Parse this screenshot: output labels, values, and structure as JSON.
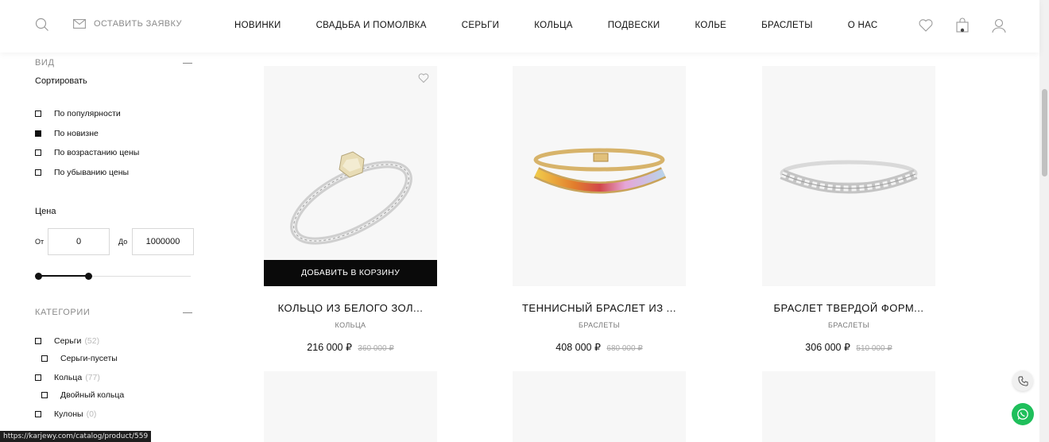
{
  "header": {
    "request_label": "ОСТАВИТЬ ЗАЯВКУ",
    "icons": [
      "search-icon",
      "mail-icon",
      "heart-icon",
      "bag-icon",
      "user-icon"
    ],
    "nav": [
      "НОВИНКИ",
      "СВАДЬБА И ПОМОЛВКА",
      "СЕРЬГИ",
      "КОЛЬЦА",
      "ПОДВЕСКИ",
      "КОЛЬЕ",
      "БРАСЛЕТЫ",
      "О НАС"
    ]
  },
  "sidebar": {
    "view_title": "ВИД",
    "sort_label": "Сортировать",
    "sort_options": [
      {
        "label": "По популярности",
        "checked": false
      },
      {
        "label": "По новизне",
        "checked": true
      },
      {
        "label": "По возрастанию цены",
        "checked": false
      },
      {
        "label": "По убыванию цены",
        "checked": false
      }
    ],
    "price_label": "Цена",
    "from_label": "От",
    "to_label": "До",
    "price_from": "0",
    "price_to": "1000000",
    "categories_title": "КАТЕГОРИИ",
    "categories": [
      {
        "label": "Серьги",
        "count": "(52)"
      },
      {
        "label": "Серьги-пусеты",
        "count": ""
      },
      {
        "label": "Кольца",
        "count": "(77)"
      },
      {
        "label": "Двойный кольца",
        "count": ""
      },
      {
        "label": "Кулоны",
        "count": "(0)"
      }
    ]
  },
  "products": [
    {
      "name": "КОЛЬЦО ИЗ БЕЛОГО ЗОЛ...",
      "category": "КОЛЬЦА",
      "price": "216 000 ₽",
      "old_price": "360 000 ₽",
      "button": "ДОБАВИТЬ В КОРЗИНУ"
    },
    {
      "name": "ТЕННИСНЫЙ БРАСЛЕТ ИЗ ...",
      "category": "БРАСЛЕТЫ",
      "price": "408 000 ₽",
      "old_price": "680 000 ₽"
    },
    {
      "name": "БРАСЛЕТ ТВЕРДОЙ ФОРМ...",
      "category": "БРАСЛЕТЫ",
      "price": "306 000 ₽",
      "old_price": "510 000 ₽"
    }
  ],
  "status_url": "https://karjewy.com/catalog/product/559",
  "colors": {
    "accent": "#0a0a0a",
    "whatsapp": "#1fbf5b",
    "muted": "#8a8a8a"
  }
}
